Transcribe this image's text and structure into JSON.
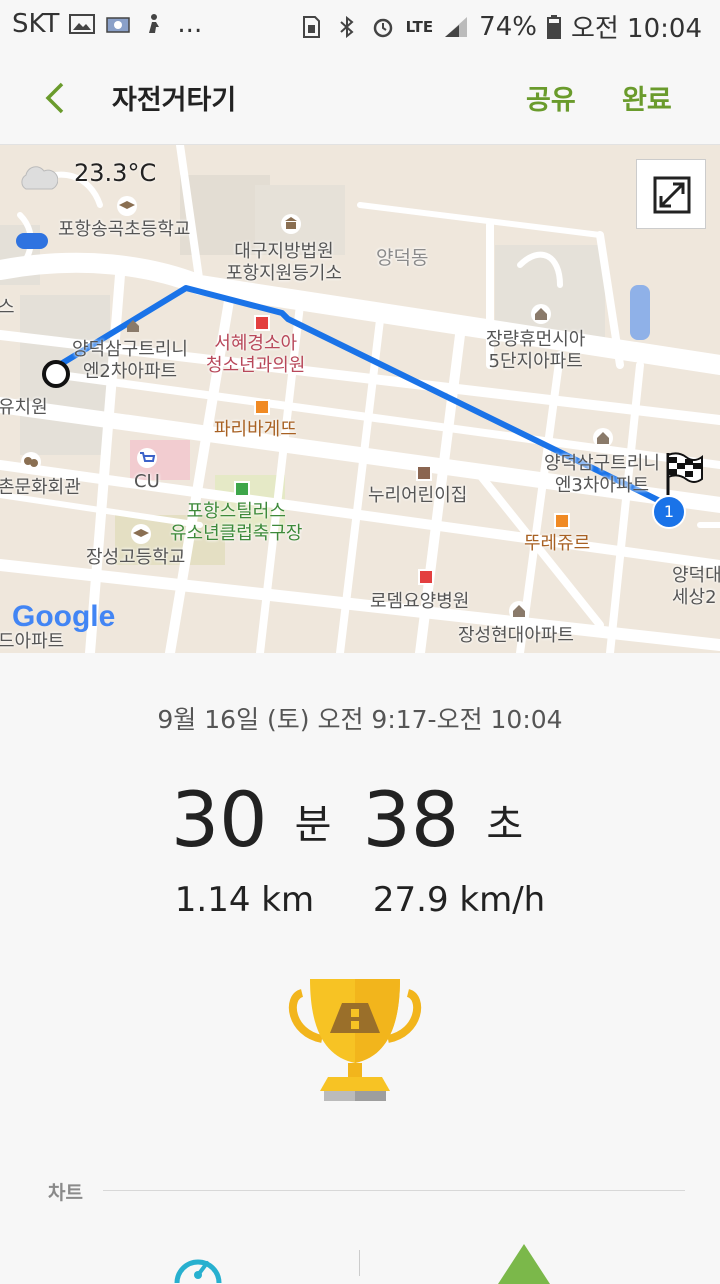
{
  "status_bar": {
    "carrier": "SKT",
    "more": "...",
    "network": "LTE",
    "battery": "74%",
    "time": "오전 10:04",
    "icons": [
      "image-icon",
      "photo-icon",
      "person-icon",
      "sim-icon",
      "bluetooth-icon",
      "alarm-icon",
      "signal-icon",
      "battery-icon"
    ]
  },
  "header": {
    "title": "자전거타기",
    "share_label": "공유",
    "done_label": "완료",
    "accent_color": "#6a9b2c"
  },
  "map": {
    "temperature": "23.3°C",
    "google_logo": "Google",
    "labels": [
      {
        "text": "포항송곡초등학교"
      },
      {
        "text": "대구지방법원\n포항지원등기소"
      },
      {
        "text": "양덕동"
      },
      {
        "text": "장량휴먼시아\n5단지아파트"
      },
      {
        "text": "양덕삼구트리니\n엔2차아파트"
      },
      {
        "text": "서혜경소아\n청소년과의원"
      },
      {
        "text": "유치원"
      },
      {
        "text": "파리바게뜨"
      },
      {
        "text": "양덕삼구트리니\n엔3차아파트"
      },
      {
        "text": "촌문화회관"
      },
      {
        "text": "CU"
      },
      {
        "text": "누리어린이집"
      },
      {
        "text": "포항스틸러스\n유소년클럽축구장"
      },
      {
        "text": "뚜레쥬르"
      },
      {
        "text": "장성고등학교"
      },
      {
        "text": "양덕대\n세상2"
      },
      {
        "text": "로뎀요양병원"
      },
      {
        "text": "드아파트"
      },
      {
        "text": "장성현대아파트"
      },
      {
        "text": "스"
      }
    ],
    "end_marker": "1",
    "route_color": "#1a73e8"
  },
  "summary": {
    "date": "9월 16일 (토) 오전 9:17-오전 10:04",
    "minutes": "30",
    "minutes_unit": "분",
    "seconds": "38",
    "seconds_unit": "초",
    "distance": "1.14 km",
    "speed": "27.9 km/h"
  },
  "chart_section": {
    "label": "차트"
  }
}
